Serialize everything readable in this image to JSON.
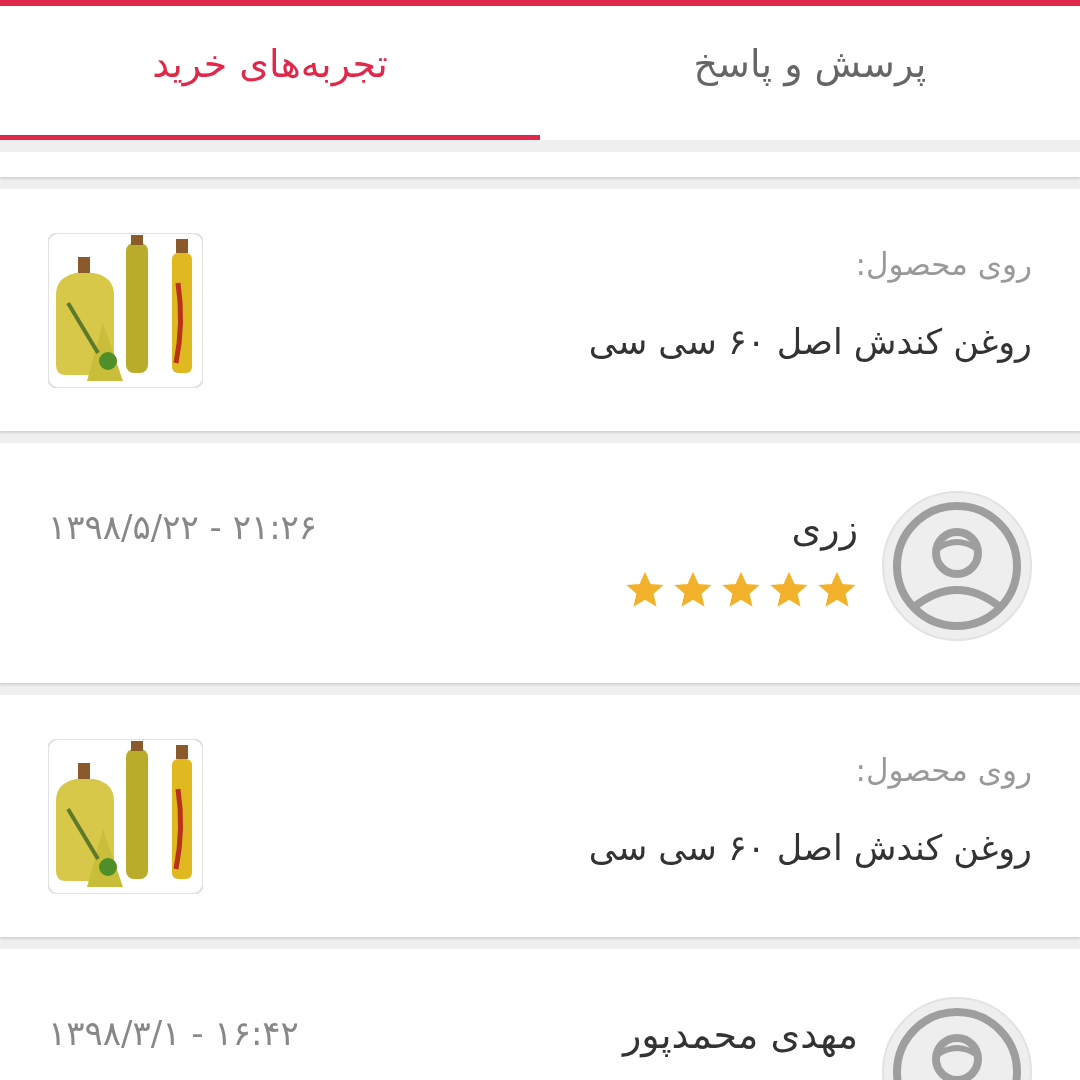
{
  "tabs": [
    {
      "label": "پرسش و پاسخ",
      "selected": false
    },
    {
      "label": "تجربه‌های خرید",
      "selected": true
    }
  ],
  "feed": [
    {
      "kind": "product",
      "caption": "روی محصول:",
      "title": "روغن کندش اصل ۶۰ سی سی"
    },
    {
      "kind": "review",
      "author": "زری",
      "stars": 5,
      "date": "۱۳۹۸/۵/۲۲ - ۲۱:۲۶"
    },
    {
      "kind": "product",
      "caption": "روی محصول:",
      "title": "روغن کندش اصل ۶۰ سی سی"
    },
    {
      "kind": "review",
      "author": "مهدی محمدپور",
      "date": "۱۳۹۸/۳/۱ - ۱۶:۴۲"
    }
  ]
}
